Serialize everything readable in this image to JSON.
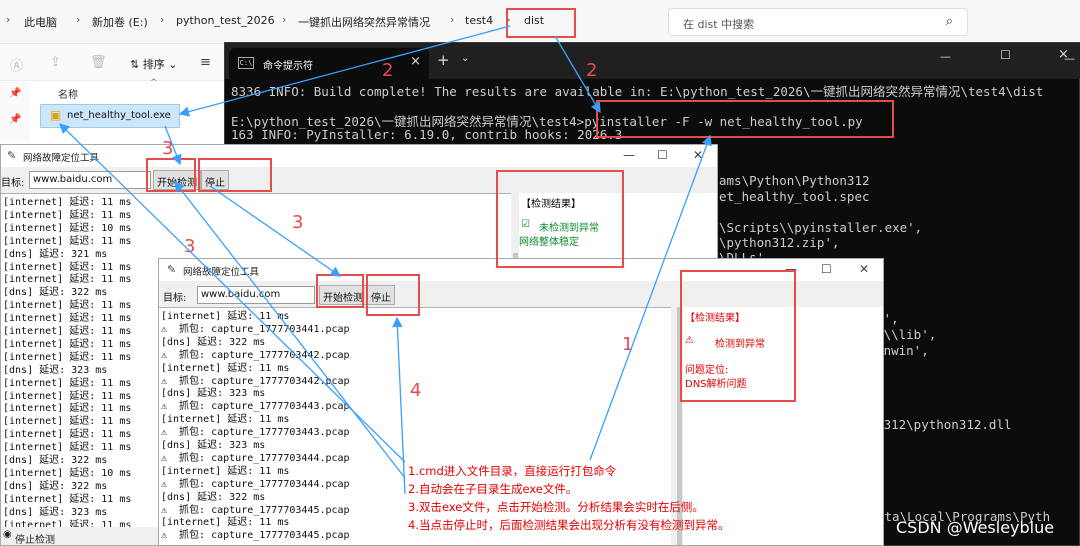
{
  "explorer": {
    "breadcrumbs": [
      "此电脑",
      "新加卷 (E:)",
      "python_test_2026",
      "一键抓出网络突然异常情况",
      "test4",
      "dist"
    ],
    "search_placeholder": "在 dist 中搜索",
    "sort_label": "排序",
    "column_name": "名称",
    "file_name": "net_healthy_tool.exe"
  },
  "cmd": {
    "tab_title": "命令提示符",
    "lines": [
      "8336 INFO: Build complete! The results are available in: E:\\python_test_2026\\一键抓出网络突然异常情况\\test4\\dist",
      "",
      "E:\\python_test_2026\\一键抓出网络突然异常情况\\test4>pyinstaller -F -w net_healthy_tool.py",
      "163 INFO: PyInstaller: 6.19.0, contrib hooks: 2026.3"
    ],
    "fragments": [
      {
        "text": "ams\\Python\\Python312"
      },
      {
        "text": "et_healthy_tool.spec"
      },
      {
        "text": "\\Scripts\\\\pyinstaller.exe',"
      },
      {
        "text": "\\python312.zip',"
      },
      {
        "text": "\\DLLs',"
      },
      {
        "text": "n32',"
      },
      {
        "text": "n32\\\\lib',"
      },
      {
        "text": "thonwin',"
      },
      {
        "text": "hon312\\python312.dll"
      },
      {
        "text": "ata\\Local\\Programs\\Pyth"
      }
    ]
  },
  "tk1": {
    "title": "网络故障定位工具",
    "target_label": "目标:",
    "target_value": "www.baidu.com",
    "start_label": "开始检测",
    "stop_label": "停止",
    "result_title": "【检测结果】",
    "result_status": "未检测到异常",
    "result_detail": "网络整体稳定",
    "status_radio": "停止检测",
    "log": [
      "[internet] 延迟: 11 ms",
      "[internet] 延迟: 11 ms",
      "[internet] 延迟: 10 ms",
      "[internet] 延迟: 11 ms",
      "[dns] 延迟: 321 ms",
      "[internet] 延迟: 11 ms",
      "[internet] 延迟: 11 ms",
      "[dns] 延迟: 322 ms",
      "[internet] 延迟: 11 ms",
      "[internet] 延迟: 11 ms",
      "[internet] 延迟: 11 ms",
      "[internet] 延迟: 11 ms",
      "[internet] 延迟: 11 ms",
      "[dns] 延迟: 323 ms",
      "[internet] 延迟: 11 ms",
      "[internet] 延迟: 11 ms",
      "[internet] 延迟: 11 ms",
      "[internet] 延迟: 11 ms",
      "[internet] 延迟: 11 ms",
      "[internet] 延迟: 11 ms",
      "[dns] 延迟: 322 ms",
      "[internet] 延迟: 10 ms",
      "[dns] 延迟: 322 ms",
      "[internet] 延迟: 11 ms",
      "[dns] 延迟: 323 ms",
      "[internet] 延迟: 11 ms"
    ]
  },
  "tk2": {
    "title": "网络故障定位工具",
    "target_label": "目标:",
    "target_value": "www.baidu.com",
    "start_label": "开始检测",
    "stop_label": "停止",
    "result_title": "【检测结果】",
    "result_status": "检测到异常",
    "result_locate_label": "问题定位:",
    "result_locate_value": "DNS解析问题",
    "log": [
      "[internet] 延迟: 11 ms",
      "⚠  抓包: capture_1777703441.pcap",
      "[dns] 延迟: 322 ms",
      "⚠  抓包: capture_1777703442.pcap",
      "[internet] 延迟: 11 ms",
      "⚠  抓包: capture_1777703442.pcap",
      "[dns] 延迟: 323 ms",
      "⚠  抓包: capture_1777703443.pcap",
      "[internet] 延迟: 11 ms",
      "⚠  抓包: capture_1777703443.pcap",
      "[dns] 延迟: 323 ms",
      "⚠  抓包: capture_1777703444.pcap",
      "[internet] 延迟: 11 ms",
      "⚠  抓包: capture_1777703444.pcap",
      "[dns] 延迟: 322 ms",
      "⚠  抓包: capture_1777703445.pcap",
      "[internet] 延迟: 11 ms",
      "⚠  抓包: capture_1777703445.pcap"
    ]
  },
  "annotations": {
    "numbers": [
      "2",
      "2",
      "3",
      "3",
      "3",
      "1",
      "4"
    ],
    "notes": [
      "1.cmd进入文件目录，直接运行打包命令",
      "2.自动会在子目录生成exe文件。",
      "3.双击exe文件，点击开始检测。分析结果会实时在后侧。",
      "4.当点击停止时，后面检测结果会出现分析有没有检测到异常。"
    ],
    "watermark": "CSDN @Wesleyblue",
    "color": "#e74c4c"
  }
}
